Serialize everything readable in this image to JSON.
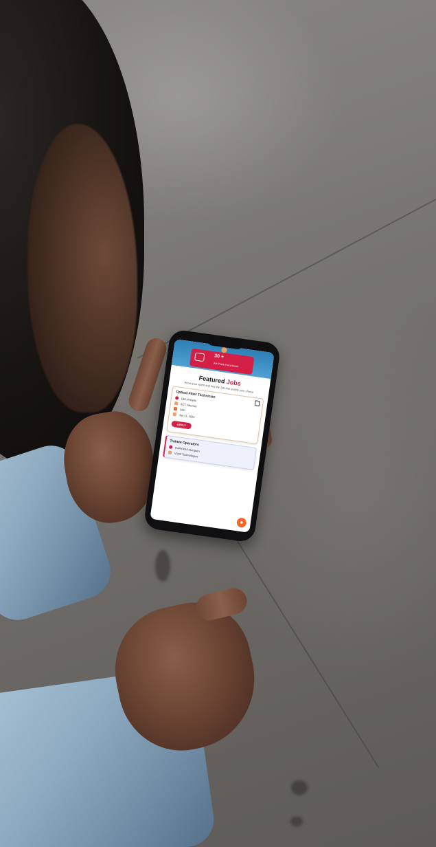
{
  "app": {
    "stat": {
      "value": "30 +",
      "label": "Job Posts Every Month"
    },
    "section": {
      "title_main": "Featured",
      "title_accent": "Jobs",
      "subtitle": "Know your worth and find the Job that qualify your choice"
    },
    "jobs": [
      {
        "title": "Optical Fiber Technician",
        "location": "DELHI-Delhi",
        "company": "ACT Fibernet",
        "qualification": "12th",
        "date": "Jan 11, 2023",
        "apply_label": "APPLY"
      },
      {
        "title": "Trainee Operators",
        "location": "HARYANA-Gurgaon",
        "company": "VIVIN Technologies"
      }
    ],
    "colors": {
      "accent": "#d31f45",
      "fab": "#f0682f",
      "hero": "#2e7fb5"
    },
    "icons": [
      "briefcase-icon",
      "location-pin-icon",
      "building-icon",
      "graduation-cap-icon",
      "calendar-icon",
      "bookmark-icon",
      "chat-icon"
    ]
  }
}
